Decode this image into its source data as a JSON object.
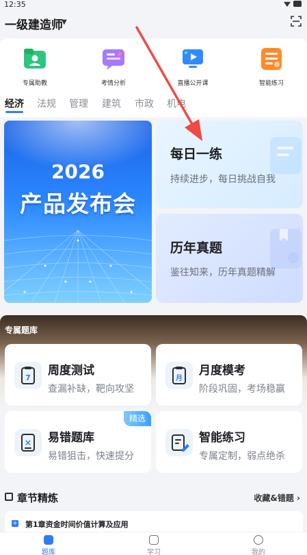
{
  "status": {
    "time": "12:35"
  },
  "header": {
    "title": "一级建造师"
  },
  "quick_actions": [
    {
      "label": "专属助教",
      "icon": "folder-user-icon",
      "color": "#1fbf72"
    },
    {
      "label": "考情分析",
      "icon": "chat-analysis-icon",
      "color": "#9a6bff"
    },
    {
      "label": "直播公开课",
      "icon": "live-class-icon",
      "color": "#2f8bff"
    },
    {
      "label": "智能练习",
      "icon": "smart-practice-icon",
      "color": "#ff8a2a"
    }
  ],
  "subject_tabs": [
    "经济",
    "法规",
    "管理",
    "建筑",
    "市政",
    "机电"
  ],
  "banner": {
    "year": "2026",
    "name": "产品发布会"
  },
  "daily": {
    "title": "每日一练",
    "subtitle": "持续进步，每日挑战自我"
  },
  "past_exams": {
    "title": "历年真题",
    "subtitle": "鉴往知来，历年真题精解"
  },
  "exclusive": {
    "title": "专属题库",
    "tiles": [
      {
        "title": "周度测试",
        "subtitle": "查漏补缺，靶向攻坚",
        "icon_text": "7"
      },
      {
        "title": "月度模考",
        "subtitle": "阶段巩固，考场稳赢",
        "icon_text": "月"
      },
      {
        "title": "易错题库",
        "subtitle": "易错狙击，快速提分",
        "icon_text": "×",
        "badge": "精选"
      },
      {
        "title": "智能练习",
        "subtitle": "专属定制，弱点绝杀",
        "icon_text": "✎"
      }
    ]
  },
  "chapter_section": {
    "title": "章节精炼",
    "link": "收藏&错题 ›"
  },
  "chapters": [
    {
      "title": "第1章资金时间价值计算及应用"
    }
  ],
  "bottom_nav": [
    {
      "label": "题库",
      "active": true
    },
    {
      "label": "学习",
      "active": false
    },
    {
      "label": "我的",
      "active": false
    }
  ],
  "colors": {
    "accent": "#2f7bff",
    "arrow": "#ef4a43"
  }
}
